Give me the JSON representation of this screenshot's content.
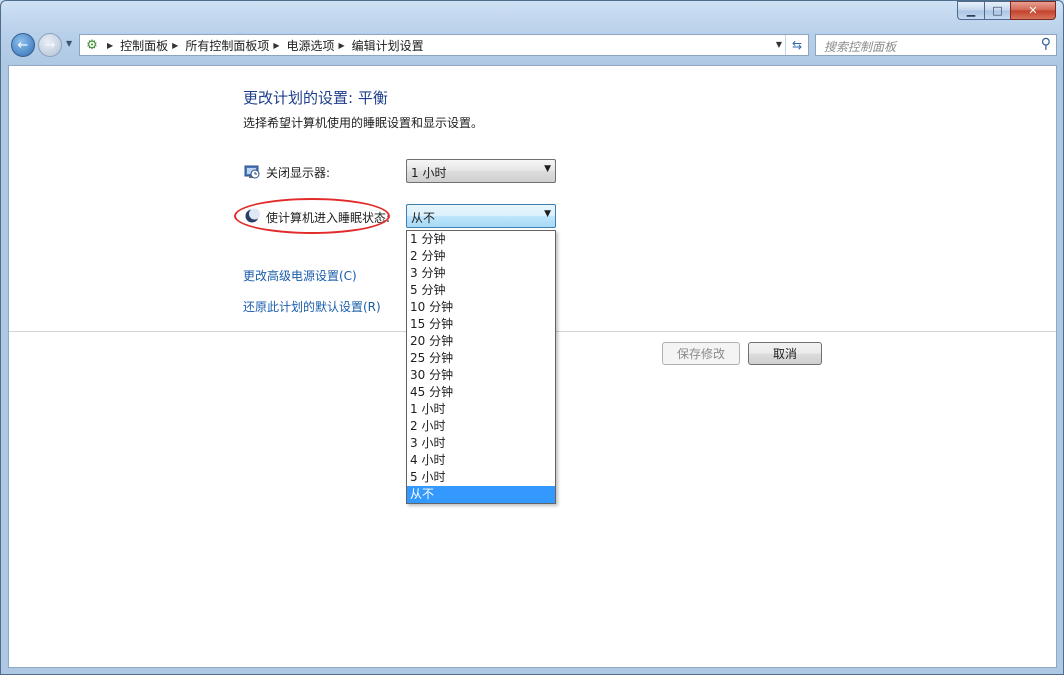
{
  "window": {
    "caption_buttons": {
      "minimize_icon": "minimize-icon",
      "maximize_icon": "maximize-icon",
      "close_icon": "close-icon"
    }
  },
  "navigation": {
    "back_icon": "back-arrow-icon",
    "forward_icon": "forward-arrow-icon",
    "breadcrumbs": [
      "控制面板",
      "所有控制面板项",
      "电源选项",
      "编辑计划设置"
    ],
    "search_placeholder": "搜索控制面板"
  },
  "main": {
    "title": "更改计划的设置: 平衡",
    "subtitle": "选择希望计算机使用的睡眠设置和显示设置。",
    "settings": [
      {
        "icon": "monitor-clock-icon",
        "label": "关闭显示器:",
        "value": "1 小时"
      },
      {
        "icon": "moon-icon",
        "label": "使计算机进入睡眠状态:",
        "value": "从不"
      }
    ],
    "links": [
      "更改高级电源设置(C)",
      "还原此计划的默认设置(R)"
    ],
    "buttons": {
      "save": "保存修改",
      "cancel": "取消"
    }
  },
  "dropdown": {
    "options": [
      "1 分钟",
      "2 分钟",
      "3 分钟",
      "5 分钟",
      "10 分钟",
      "15 分钟",
      "20 分钟",
      "25 分钟",
      "30 分钟",
      "45 分钟",
      "1 小时",
      "2 小时",
      "3 小时",
      "4 小时",
      "5 小时",
      "从不"
    ],
    "selected": "从不"
  },
  "colors": {
    "title": "#1e3f8a",
    "link": "#1b5dab",
    "highlight": "#3399ff",
    "annotation": "#e12a2a"
  }
}
